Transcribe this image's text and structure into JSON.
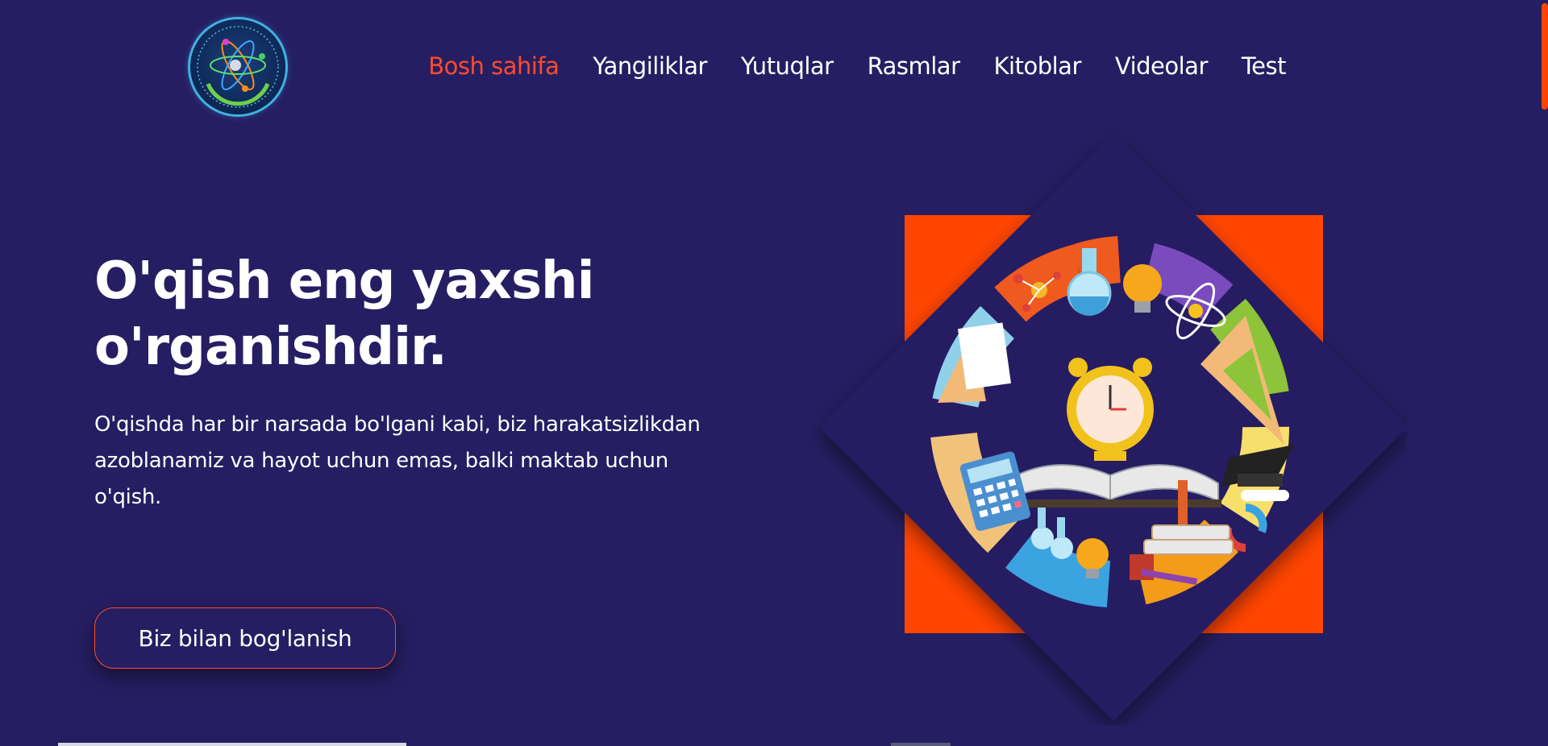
{
  "nav": {
    "items": [
      {
        "label": "Bosh sahifa",
        "active": true
      },
      {
        "label": "Yangiliklar",
        "active": false
      },
      {
        "label": "Yutuqlar",
        "active": false
      },
      {
        "label": "Rasmlar",
        "active": false
      },
      {
        "label": "Kitoblar",
        "active": false
      },
      {
        "label": "Videolar",
        "active": false
      },
      {
        "label": "Test",
        "active": false
      }
    ]
  },
  "hero": {
    "title_line1": "O'qish eng yaxshi",
    "title_line2": "o'rganishdir.",
    "text_line1": "O'qishda har bir narsada bo'lgani kabi, biz harakatsizlikdan",
    "text_line2": "azoblanamiz va hayot uchun emas, balki maktab uchun",
    "text_line3": "o'qish.",
    "cta_label": "Biz bilan bog'lanish"
  },
  "colors": {
    "background": "#261e62",
    "accent": "#ff4500",
    "active_link": "#ff4b2b"
  },
  "icons": {
    "logo": "atom-logo-icon",
    "illustration": "education-circle-illustration"
  }
}
